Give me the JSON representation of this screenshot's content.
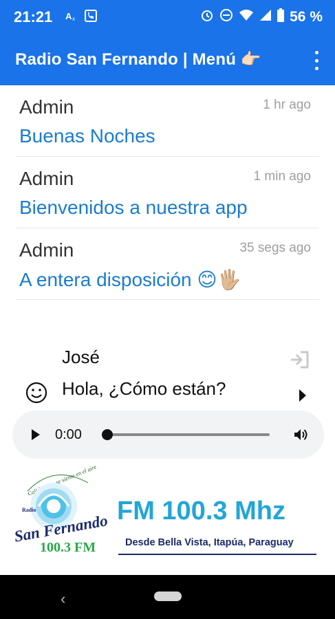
{
  "status_bar": {
    "time": "21:21",
    "battery": "56 %",
    "icons": [
      "translate-icon",
      "phone-icon",
      "alarm-icon",
      "dnd-icon",
      "wifi-icon",
      "signal-icon",
      "battery-icon"
    ]
  },
  "app_bar": {
    "title": "Radio San Fernando | Menú 👉🏻",
    "menu_icon": "more-vert-icon"
  },
  "messages": [
    {
      "author": "Admin",
      "time": "1 hr ago",
      "text": "Buenas Noches"
    },
    {
      "author": "Admin",
      "time": "1 min ago",
      "text": "Bienvenidos a nuestra app"
    },
    {
      "author": "Admin",
      "time": "35 segs ago",
      "text": "A entera disposición 😊🖐🏼"
    }
  ],
  "compose": {
    "user": "José",
    "message": "Hola, ¿Cómo están?"
  },
  "player": {
    "current_time": "0:00",
    "progress": 0
  },
  "banner": {
    "logo_text": [
      "Calidad que se siente en el aire",
      "Radio",
      "San Fernando",
      "100.3 FM"
    ],
    "frequency": "FM 100.3 Mhz",
    "location": "Desde Bella Vista, Itapúa, Paraguay"
  },
  "colors": {
    "primary": "#1a73e8",
    "message_text": "#1a7ccf",
    "banner_blue": "#21a6d6",
    "banner_navy": "#1d2a6b"
  }
}
